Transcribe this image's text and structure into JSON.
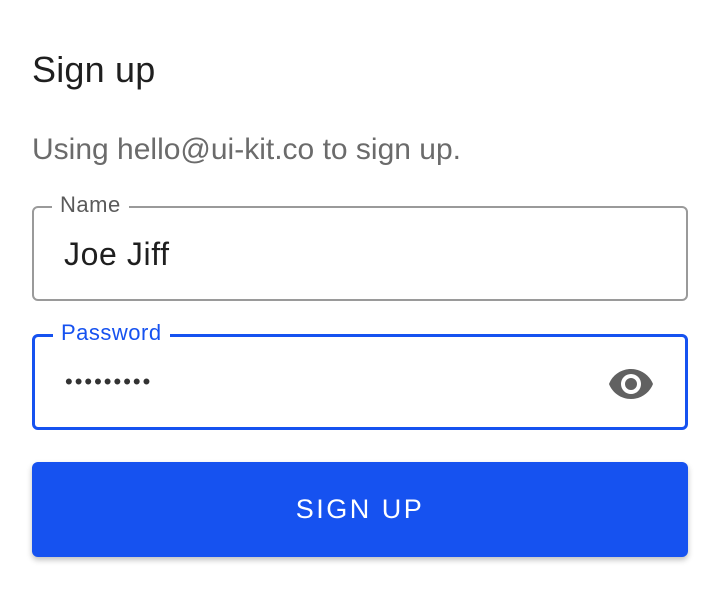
{
  "form": {
    "title": "Sign up",
    "subtitle": "Using hello@ui-kit.co to sign up."
  },
  "name_field": {
    "label": "Name",
    "value": "Joe Jiff"
  },
  "password_field": {
    "label": "Password",
    "masked_value": "•••••••••",
    "toggle_icon": "eye-icon",
    "state": "focused"
  },
  "signup_button": {
    "label": "SIGN UP"
  },
  "colors": {
    "accent": "#1652f0",
    "title_text": "#1f1f1f",
    "subtitle_text": "#6b6b6b",
    "border": "#9a9a9a"
  }
}
